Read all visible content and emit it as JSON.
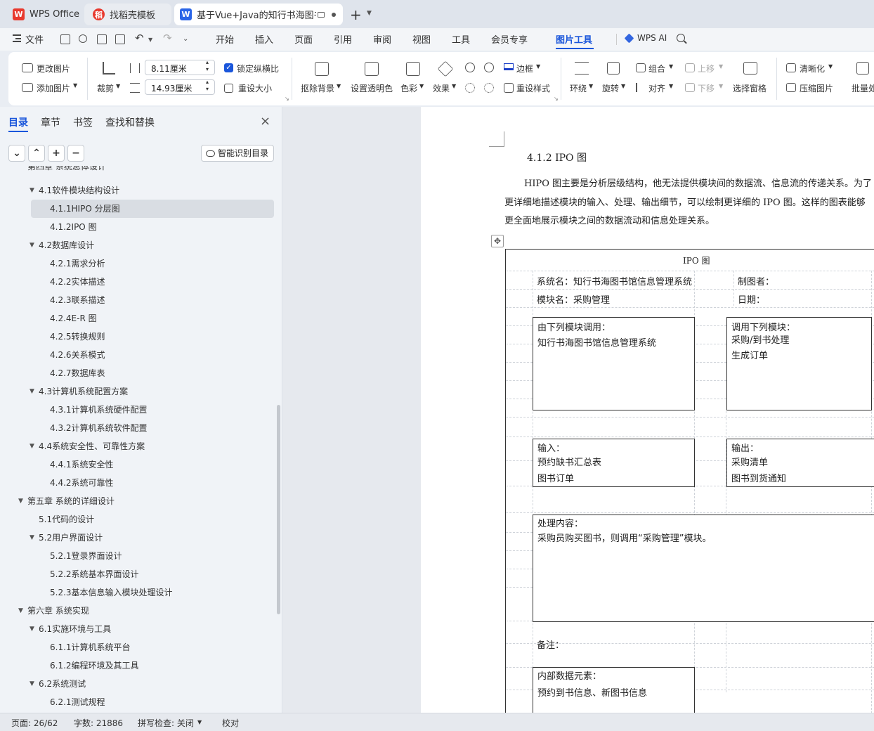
{
  "tabs": [
    {
      "label": "WPS Office"
    },
    {
      "label": "找稻壳模板"
    },
    {
      "label": "基于Vue+Java的知行书海图书"
    }
  ],
  "menu": {
    "file": "文件",
    "items": [
      "开始",
      "插入",
      "页面",
      "引用",
      "审阅",
      "视图",
      "工具",
      "会员专享",
      "图片工具"
    ],
    "wps_ai": "WPS AI"
  },
  "ribbon": {
    "change_image": "更改图片",
    "add_image": "添加图片",
    "crop": "裁剪",
    "width": "8.11厘米",
    "height": "14.93厘米",
    "lock_ratio": "锁定纵横比",
    "reset_size": "重设大小",
    "remove_bg": "抠除背景",
    "set_transparent": "设置透明色",
    "color": "色彩",
    "effect": "效果",
    "border": "边框",
    "reset_style": "重设样式",
    "wrap": "环绕",
    "rotate": "旋转",
    "group": "组合",
    "align": "对齐",
    "move_up": "上移",
    "move_down": "下移",
    "select_pane": "选择窗格",
    "sharpen": "清晰化",
    "compress": "压缩图片",
    "batch": "批量处理"
  },
  "sidebar": {
    "tabs": [
      "目录",
      "章节",
      "书签",
      "查找和替换"
    ],
    "smart_toc": "智能识别目录",
    "cut_item": "第四章 系统总体设计",
    "toc": [
      {
        "label": "4.1软件模块结构设计",
        "level": 2,
        "arrow": true
      },
      {
        "label": "4.1.1HIPO 分层图",
        "level": 3,
        "selected": true
      },
      {
        "label": "4.1.2IPO 图",
        "level": 3
      },
      {
        "label": "4.2数据库设计",
        "level": 2,
        "arrow": true
      },
      {
        "label": "4.2.1需求分析",
        "level": 3
      },
      {
        "label": "4.2.2实体描述",
        "level": 3
      },
      {
        "label": "4.2.3联系描述",
        "level": 3
      },
      {
        "label": "4.2.4E-R 图",
        "level": 3
      },
      {
        "label": "4.2.5转换规则",
        "level": 3
      },
      {
        "label": "4.2.6关系模式",
        "level": 3
      },
      {
        "label": "4.2.7数据库表",
        "level": 3
      },
      {
        "label": "4.3计算机系统配置方案",
        "level": 2,
        "arrow": true
      },
      {
        "label": "4.3.1计算机系统硬件配置",
        "level": 3
      },
      {
        "label": "4.3.2计算机系统软件配置",
        "level": 3
      },
      {
        "label": "4.4系统安全性、可靠性方案",
        "level": 2,
        "arrow": true
      },
      {
        "label": "4.4.1系统安全性",
        "level": 3
      },
      {
        "label": "4.4.2系统可靠性",
        "level": 3
      },
      {
        "label": "第五章  系统的详细设计",
        "level": 1,
        "arrow": true
      },
      {
        "label": "5.1代码的设计",
        "level": 2
      },
      {
        "label": "5.2用户界面设计",
        "level": 2,
        "arrow": true
      },
      {
        "label": "5.2.1登录界面设计",
        "level": 3
      },
      {
        "label": "5.2.2系统基本界面设计",
        "level": 3
      },
      {
        "label": "5.2.3基本信息输入模块处理设计",
        "level": 3
      },
      {
        "label": "第六章  系统实现",
        "level": 1,
        "arrow": true
      },
      {
        "label": "6.1实施环境与工具",
        "level": 2,
        "arrow": true
      },
      {
        "label": "6.1.1计算机系统平台",
        "level": 3
      },
      {
        "label": "6.1.2编程环境及其工具",
        "level": 3
      },
      {
        "label": "6.2系统测试",
        "level": 2,
        "arrow": true
      },
      {
        "label": "6.2.1测试规程",
        "level": 3
      }
    ]
  },
  "doc": {
    "heading": "4.1.2  IPO 图",
    "para": [
      "HIPO 图主要是分析层级结构，他无法提供模块间的数据流、信息流的传递关系。为了",
      "更详细地描述模块的输入、处理、输出细节，可以绘制更详细的 IPO 图。这样的图表能够",
      "更全面地展示模块之间的数据流动和信息处理关系。"
    ],
    "ipo": {
      "title": "IPO 图",
      "system": "系统名：知行书海图书馆信息管理系统",
      "author": "制图者：",
      "module": "模块名：采购管理",
      "date": "日期：",
      "called_by": [
        "由下列模块调用：",
        "知行书海图书馆信息管理系统"
      ],
      "calls": [
        "调用下列模块：",
        "采购/到书处理",
        "生成订单"
      ],
      "input": [
        "输入：",
        "预约缺书汇总表",
        "图书订单"
      ],
      "output": [
        "输出：",
        "采购清单",
        "图书到货通知"
      ],
      "process": [
        "处理内容：",
        "采购员购买图书，则调用“采购管理”模块。"
      ],
      "remark": "备注：",
      "internal": [
        "内部数据元素：",
        "预约到书信息、新图书信息"
      ]
    }
  },
  "status": {
    "page": "页面: 26/62",
    "words": "字数: 21886",
    "spell": "拼写检查: 关闭",
    "proof": "校对"
  }
}
